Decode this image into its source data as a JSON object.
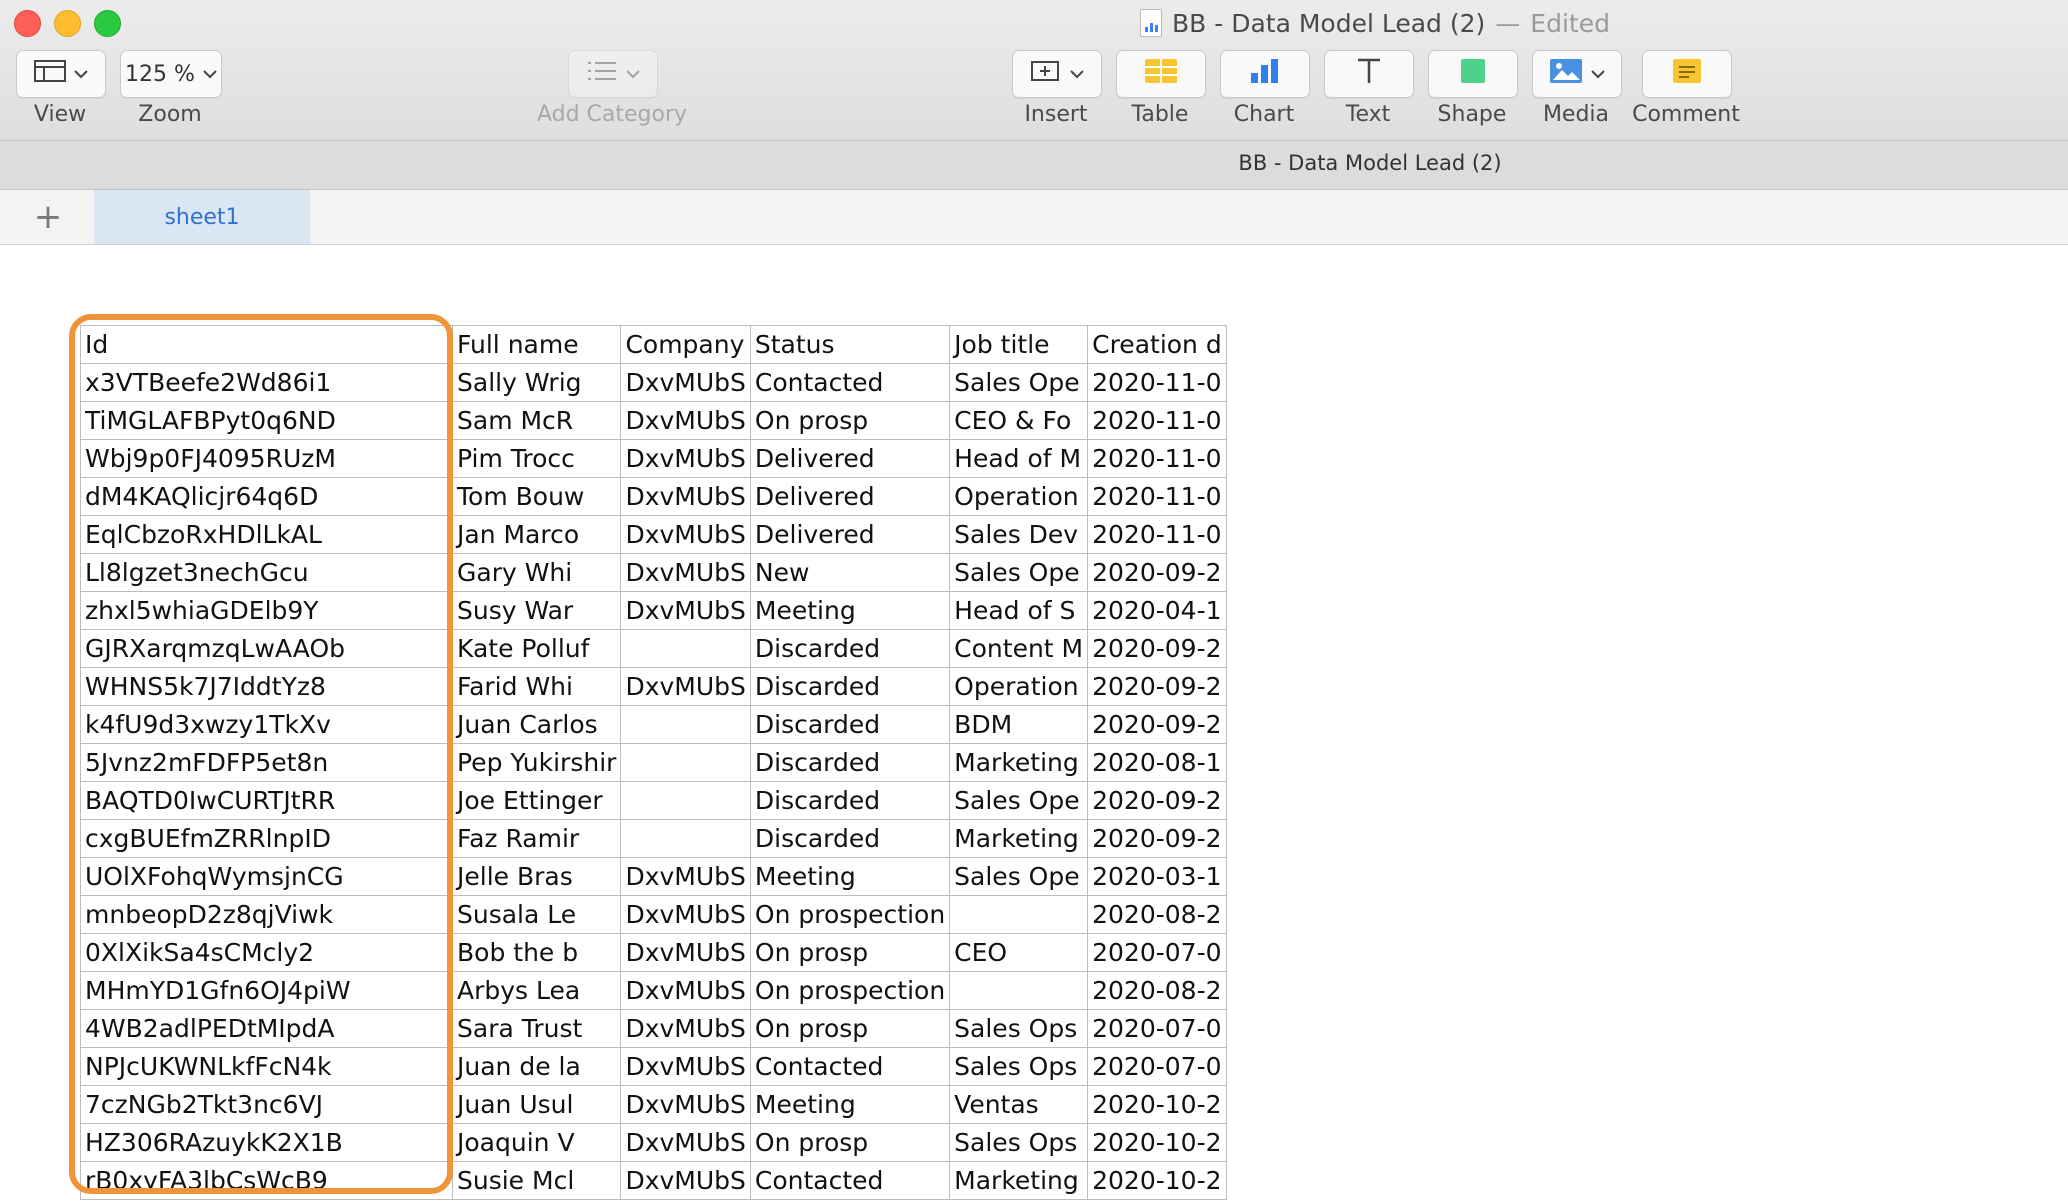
{
  "window": {
    "title": "BB - Data Model Lead (2)",
    "separator": "—",
    "status": "Edited"
  },
  "toolbar": {
    "view_label": "View",
    "zoom_value": "125 %",
    "zoom_label": "Zoom",
    "add_category_label": "Add Category",
    "insert_label": "Insert",
    "table_label": "Table",
    "chart_label": "Chart",
    "text_label": "Text",
    "shape_label": "Shape",
    "media_label": "Media",
    "comment_label": "Comment"
  },
  "document": {
    "title": "BB - Data Model Lead (2)"
  },
  "sheets": {
    "add_symbol": "+",
    "active": "sheet1"
  },
  "colors": {
    "highlight": "#f0943a",
    "active_tab_bg": "#dbe6f5",
    "active_tab_text": "#2f73d0"
  },
  "table": {
    "headers": [
      "Id",
      "Full name",
      "Company",
      "Status",
      "Job title",
      "Creation d"
    ],
    "rows": [
      [
        "x3VTBeefe2Wd86i1",
        "Sally Wrig",
        "DxvMUbS",
        "Contacted",
        "Sales Ope",
        "2020-11-0"
      ],
      [
        "TiMGLAFBPyt0q6ND",
        "Sam McR",
        "DxvMUbS",
        "On prosp",
        "CEO & Fo",
        "2020-11-0"
      ],
      [
        "Wbj9p0FJ4095RUzM",
        "Pim Trocc",
        "DxvMUbS",
        "Delivered",
        "Head of M",
        "2020-11-0"
      ],
      [
        "dM4KAQlicjr64q6D",
        "Tom Bouw",
        "DxvMUbS",
        "Delivered",
        "Operation",
        "2020-11-0"
      ],
      [
        "EqlCbzoRxHDlLkAL",
        "Jan Marco",
        "DxvMUbS",
        "Delivered",
        "Sales Dev",
        "2020-11-0"
      ],
      [
        "Ll8lgzet3nechGcu",
        "Gary Whi",
        "DxvMUbS",
        "New",
        "Sales Ope",
        "2020-09-2"
      ],
      [
        "zhxl5whiaGDElb9Y",
        "Susy War",
        "DxvMUbS",
        "Meeting",
        "Head of S",
        "2020-04-1"
      ],
      [
        "GJRXarqmzqLwAAOb",
        "Kate Polluf",
        "",
        "Discarded",
        "Content M",
        "2020-09-2"
      ],
      [
        "WHNS5k7J7IddtYz8",
        "Farid Whi",
        "DxvMUbS",
        "Discarded",
        "Operation",
        "2020-09-2"
      ],
      [
        "k4fU9d3xwzy1TkXv",
        "Juan Carlos",
        "",
        "Discarded",
        "BDM",
        "2020-09-2"
      ],
      [
        "5Jvnz2mFDFP5et8n",
        "Pep Yukirshir",
        "",
        "Discarded",
        "Marketing",
        "2020-08-1"
      ],
      [
        "BAQTD0IwCURTJtRR",
        "Joe Ettinger",
        "",
        "Discarded",
        "Sales Ope",
        "2020-09-2"
      ],
      [
        "cxgBUEfmZRRlnpID",
        "Faz Ramir",
        "",
        "Discarded",
        "Marketing",
        "2020-09-2"
      ],
      [
        "UOlXFohqWymsjnCG",
        "Jelle Bras",
        "DxvMUbS",
        "Meeting",
        "Sales Ope",
        "2020-03-1"
      ],
      [
        "mnbeopD2z8qjViwk",
        "Susala Le",
        "DxvMUbS",
        "On prospection",
        "",
        "2020-08-2"
      ],
      [
        "0XlXikSa4sCMcly2",
        "Bob the b",
        "DxvMUbS",
        "On prosp",
        "CEO",
        "2020-07-0"
      ],
      [
        "MHmYD1Gfn6OJ4piW",
        "Arbys Lea",
        "DxvMUbS",
        "On prospection",
        "",
        "2020-08-2"
      ],
      [
        "4WB2adlPEDtMIpdA",
        "Sara Trust",
        "DxvMUbS",
        "On prosp",
        "Sales Ops",
        "2020-07-0"
      ],
      [
        "NPJcUKWNLkfFcN4k",
        "Juan de la",
        "DxvMUbS",
        "Contacted",
        "Sales Ops",
        "2020-07-0"
      ],
      [
        "7czNGb2Tkt3nc6VJ",
        "Juan Usul",
        "DxvMUbS",
        "Meeting",
        "Ventas",
        "2020-10-2"
      ],
      [
        "HZ306RAzuykK2X1B",
        "Joaquin V",
        "DxvMUbS",
        "On prosp",
        "Sales Ops",
        "2020-10-2"
      ],
      [
        "rB0xyFA3lbCsWcB9",
        "Susie Mcl",
        "DxvMUbS",
        "Contacted",
        "Marketing",
        "2020-10-2"
      ]
    ]
  }
}
